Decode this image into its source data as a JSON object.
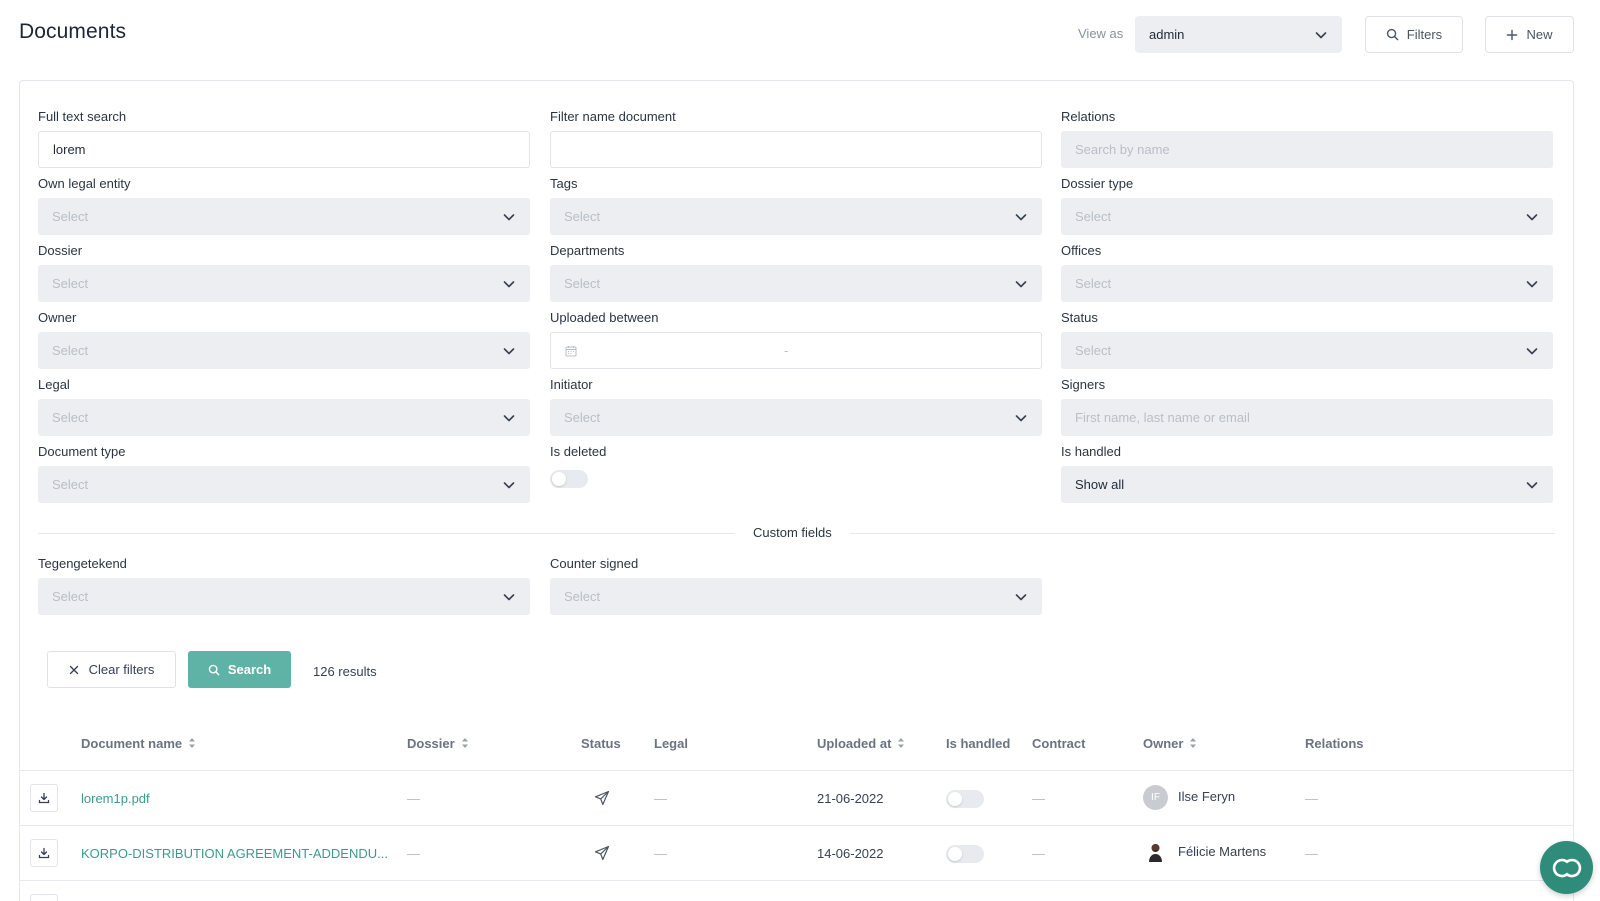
{
  "header": {
    "title": "Documents",
    "view_as_label": "View as",
    "view_as_value": "admin",
    "filters_label": "Filters",
    "new_label": "New"
  },
  "filters": {
    "full_text_search": {
      "label": "Full text search",
      "value": "lorem"
    },
    "filter_name_document": {
      "label": "Filter name document",
      "value": ""
    },
    "relations": {
      "label": "Relations",
      "placeholder": "Search by name"
    },
    "own_legal_entity": {
      "label": "Own legal entity",
      "placeholder": "Select"
    },
    "tags": {
      "label": "Tags",
      "placeholder": "Select"
    },
    "dossier_type": {
      "label": "Dossier type",
      "placeholder": "Select"
    },
    "dossier": {
      "label": "Dossier",
      "placeholder": "Select"
    },
    "departments": {
      "label": "Departments",
      "placeholder": "Select"
    },
    "offices": {
      "label": "Offices",
      "placeholder": "Select"
    },
    "owner": {
      "label": "Owner",
      "placeholder": "Select"
    },
    "uploaded_between": {
      "label": "Uploaded between",
      "separator": "-"
    },
    "status": {
      "label": "Status",
      "placeholder": "Select"
    },
    "legal": {
      "label": "Legal",
      "placeholder": "Select"
    },
    "initiator": {
      "label": "Initiator",
      "placeholder": "Select"
    },
    "signers": {
      "label": "Signers",
      "placeholder": "First name, last name or email"
    },
    "document_type": {
      "label": "Document type",
      "placeholder": "Select"
    },
    "is_deleted": {
      "label": "Is deleted",
      "on": false
    },
    "is_handled": {
      "label": "Is handled",
      "value": "Show all"
    },
    "custom_fields_label": "Custom fields",
    "tegengetekend": {
      "label": "Tegengetekend",
      "placeholder": "Select"
    },
    "counter_signed": {
      "label": "Counter signed",
      "placeholder": "Select"
    }
  },
  "actions": {
    "clear_label": "Clear filters",
    "search_label": "Search",
    "results": "126 results"
  },
  "table": {
    "columns": {
      "document_name": "Document name",
      "dossier": "Dossier",
      "status": "Status",
      "legal": "Legal",
      "uploaded_at": "Uploaded at",
      "is_handled": "Is handled",
      "contract": "Contract",
      "owner": "Owner",
      "relations": "Relations"
    },
    "rows": [
      {
        "name": "lorem1p.pdf",
        "dossier": "—",
        "legal": "—",
        "uploaded_at": "21-06-2022",
        "contract": "—",
        "owner_initials": "IF",
        "owner": "Ilse Feryn",
        "relations": "—"
      },
      {
        "name": "KORPO-DISTRIBUTION AGREEMENT-ADDENDU...",
        "dossier": "—",
        "legal": "—",
        "uploaded_at": "14-06-2022",
        "contract": "—",
        "owner": "Félicie Martens",
        "relations": "—"
      }
    ]
  },
  "colors": {
    "accent": "#5fb3a6",
    "link": "#3c9a8c",
    "fab": "#2f8c7b"
  }
}
